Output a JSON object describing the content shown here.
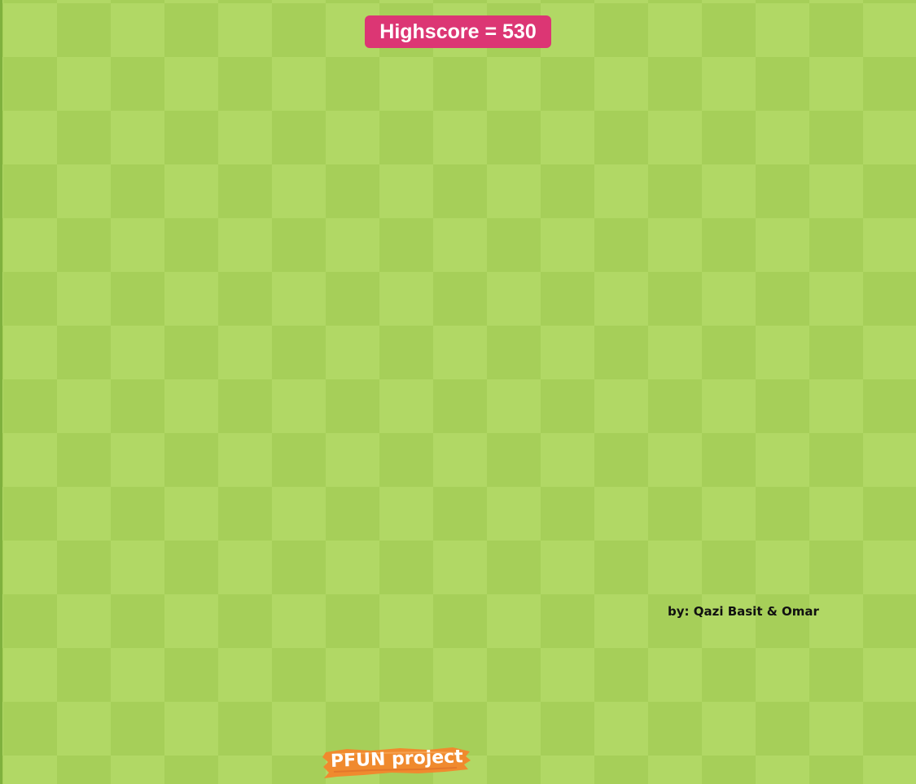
{
  "hud": {
    "highscore_label": "Highscore = 530"
  },
  "credits": {
    "text": "by: Qazi Basit & Omar"
  },
  "project_tag": {
    "text": "PFUN project"
  },
  "colors": {
    "board_light": "#b1d865",
    "board_dark": "#a6cf59",
    "highscore_bg": "#dc3674",
    "tag_bg": "#f08a2e"
  }
}
